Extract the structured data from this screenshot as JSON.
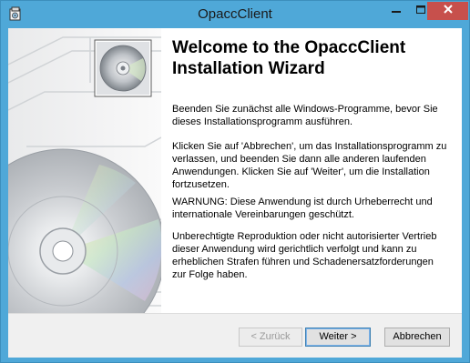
{
  "window": {
    "title": "OpaccClient",
    "app_icon": "installer-icon"
  },
  "controls": {
    "minimize_icon": "minimize-icon",
    "maximize_icon": "maximize-icon",
    "close_icon": "close-icon"
  },
  "colors": {
    "titlebar": "#4fa8d8",
    "close_button": "#c7504c"
  },
  "sidebar": {
    "image": "cd-disc-graphic"
  },
  "main": {
    "heading": "Welcome to the OpaccClient Installation Wizard",
    "paragraphs": [
      "Beenden Sie zunächst alle Windows-Programme, bevor Sie dieses Installationsprogramm ausführen.",
      "Klicken Sie auf 'Abbrechen', um das Installationsprogramm zu verlassen, und beenden Sie dann alle anderen laufenden Anwendungen. Klicken Sie auf 'Weiter', um die Installation fortzusetzen.",
      "WARNUNG: Diese Anwendung ist durch Urheberrecht und internationale Vereinbarungen geschützt.",
      "Unberechtigte Reproduktion oder nicht autorisierter Vertrieb dieser Anwendung wird gerichtlich verfolgt und kann zu erheblichen Strafen führen und Schadenersatzforderungen zur Folge haben."
    ]
  },
  "buttons": {
    "back": "< Zurück",
    "next": "Weiter >",
    "cancel": "Abbrechen"
  }
}
